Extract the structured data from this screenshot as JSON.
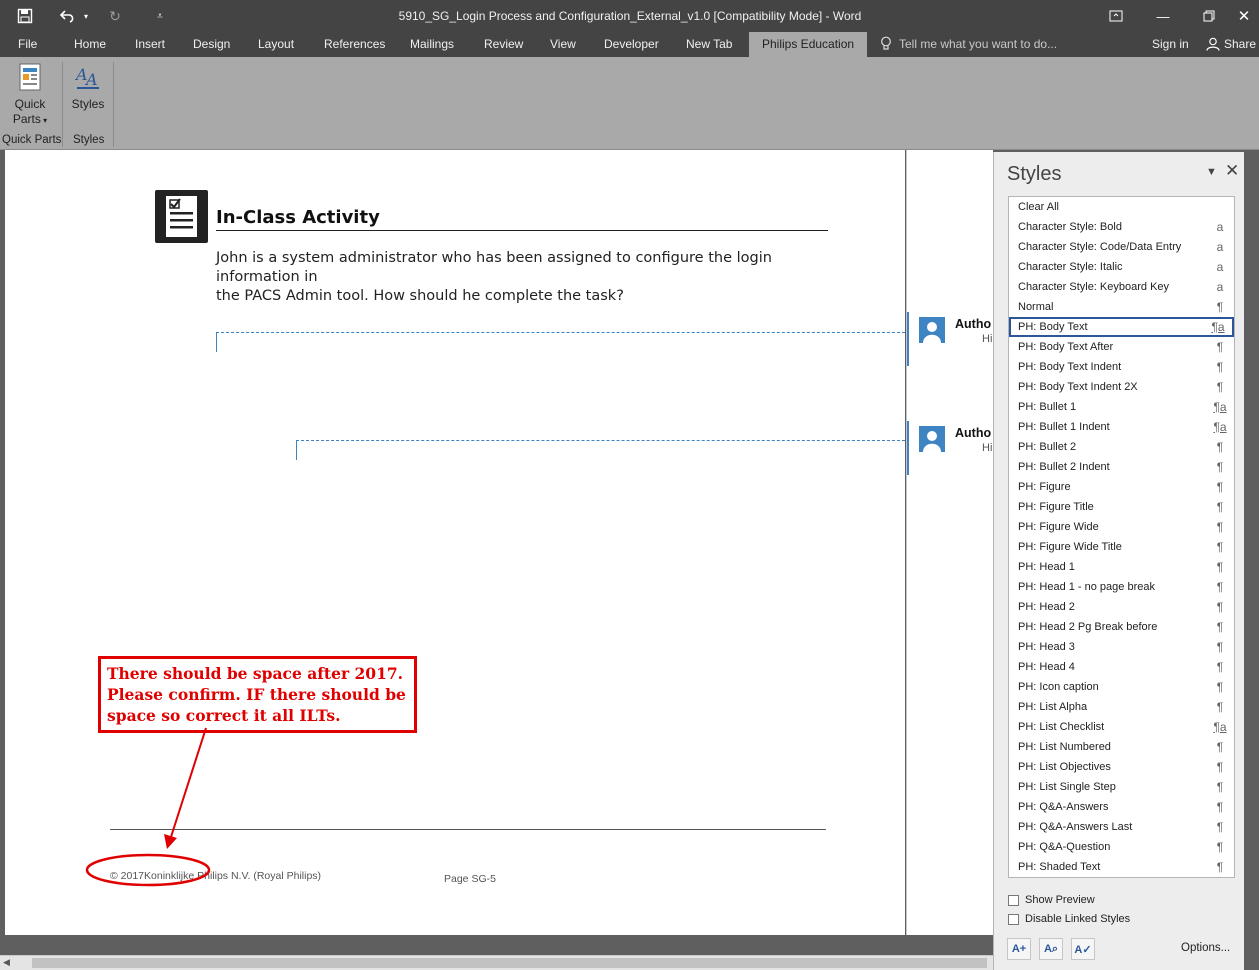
{
  "window": {
    "title": "5910_SG_Login Process and Configuration_External_v1.0 [Compatibility Mode] - Word",
    "quick_access_icons": [
      "save-icon",
      "undo-icon",
      "redo-icon",
      "customize-icon"
    ]
  },
  "tabs": {
    "items": [
      "File",
      "Home",
      "Insert",
      "Design",
      "Layout",
      "References",
      "Mailings",
      "Review",
      "View",
      "Developer",
      "New Tab",
      "Philips Education"
    ],
    "active": "Philips Education",
    "tell_me": "Tell me what you want to do...",
    "sign_in": "Sign in",
    "share": "Share"
  },
  "ribbon": {
    "quick_parts_line1": "Quick",
    "quick_parts_line2": "Parts",
    "quick_parts_group": "Quick Parts",
    "styles_button": "Styles",
    "styles_group": "Styles"
  },
  "document": {
    "activity_title": "In-Class Activity",
    "body_line1": "John is a system administrator who has been assigned to configure the login information in",
    "body_line2": "the PACS Admin tool. How should he complete the task?",
    "comments": [
      {
        "author": "Autho",
        "sub": "Hi"
      },
      {
        "author": "Autho",
        "sub": "Hi"
      }
    ],
    "footer_copyright": "© 2017Koninklijke Philips N.V. (Royal Philips)",
    "footer_page": "Page SG-5",
    "annotation": "There should be space after 2017. Please confirm. IF there should be space so correct it all ILTs."
  },
  "styles_pane": {
    "title": "Styles",
    "items": [
      {
        "label": "Clear All",
        "mark": ""
      },
      {
        "label": "Character Style: Bold",
        "mark": "a"
      },
      {
        "label": "Character Style: Code/Data Entry",
        "mark": "a"
      },
      {
        "label": "Character Style: Italic",
        "mark": "a"
      },
      {
        "label": "Character Style: Keyboard Key",
        "mark": "a"
      },
      {
        "label": "Normal",
        "mark": "¶"
      },
      {
        "label": "PH: Body Text",
        "mark": "¶a"
      },
      {
        "label": "PH: Body Text After",
        "mark": "¶"
      },
      {
        "label": "PH: Body Text Indent",
        "mark": "¶"
      },
      {
        "label": "PH: Body Text Indent 2X",
        "mark": "¶"
      },
      {
        "label": "PH: Bullet 1",
        "mark": "¶a"
      },
      {
        "label": "PH: Bullet 1 Indent",
        "mark": "¶a"
      },
      {
        "label": "PH: Bullet 2",
        "mark": "¶"
      },
      {
        "label": "PH: Bullet 2 Indent",
        "mark": "¶"
      },
      {
        "label": "PH: Figure",
        "mark": "¶"
      },
      {
        "label": "PH: Figure Title",
        "mark": "¶"
      },
      {
        "label": "PH: Figure Wide",
        "mark": "¶"
      },
      {
        "label": "PH: Figure Wide Title",
        "mark": "¶"
      },
      {
        "label": "PH: Head 1",
        "mark": "¶"
      },
      {
        "label": "PH: Head 1 - no page break",
        "mark": "¶"
      },
      {
        "label": "PH: Head 2",
        "mark": "¶"
      },
      {
        "label": "PH: Head 2 Pg Break before",
        "mark": "¶"
      },
      {
        "label": "PH: Head 3",
        "mark": "¶"
      },
      {
        "label": "PH: Head 4",
        "mark": "¶"
      },
      {
        "label": "PH: Icon caption",
        "mark": "¶"
      },
      {
        "label": "PH: List Alpha",
        "mark": "¶"
      },
      {
        "label": "PH: List Checklist",
        "mark": "¶a"
      },
      {
        "label": "PH: List Numbered",
        "mark": "¶"
      },
      {
        "label": "PH: List Objectives",
        "mark": "¶"
      },
      {
        "label": "PH: List Single Step",
        "mark": "¶"
      },
      {
        "label": "PH: Q&A-Answers",
        "mark": "¶"
      },
      {
        "label": "PH: Q&A-Answers Last",
        "mark": "¶"
      },
      {
        "label": "PH: Q&A-Question",
        "mark": "¶"
      },
      {
        "label": "PH: Shaded Text",
        "mark": "¶"
      }
    ],
    "selected": "PH: Body Text",
    "show_preview": "Show Preview",
    "disable_linked": "Disable Linked Styles",
    "options": "Options..."
  },
  "colors": {
    "accent": "#2b579a",
    "annotation": "#e00000",
    "comment": "#3e83c2"
  }
}
